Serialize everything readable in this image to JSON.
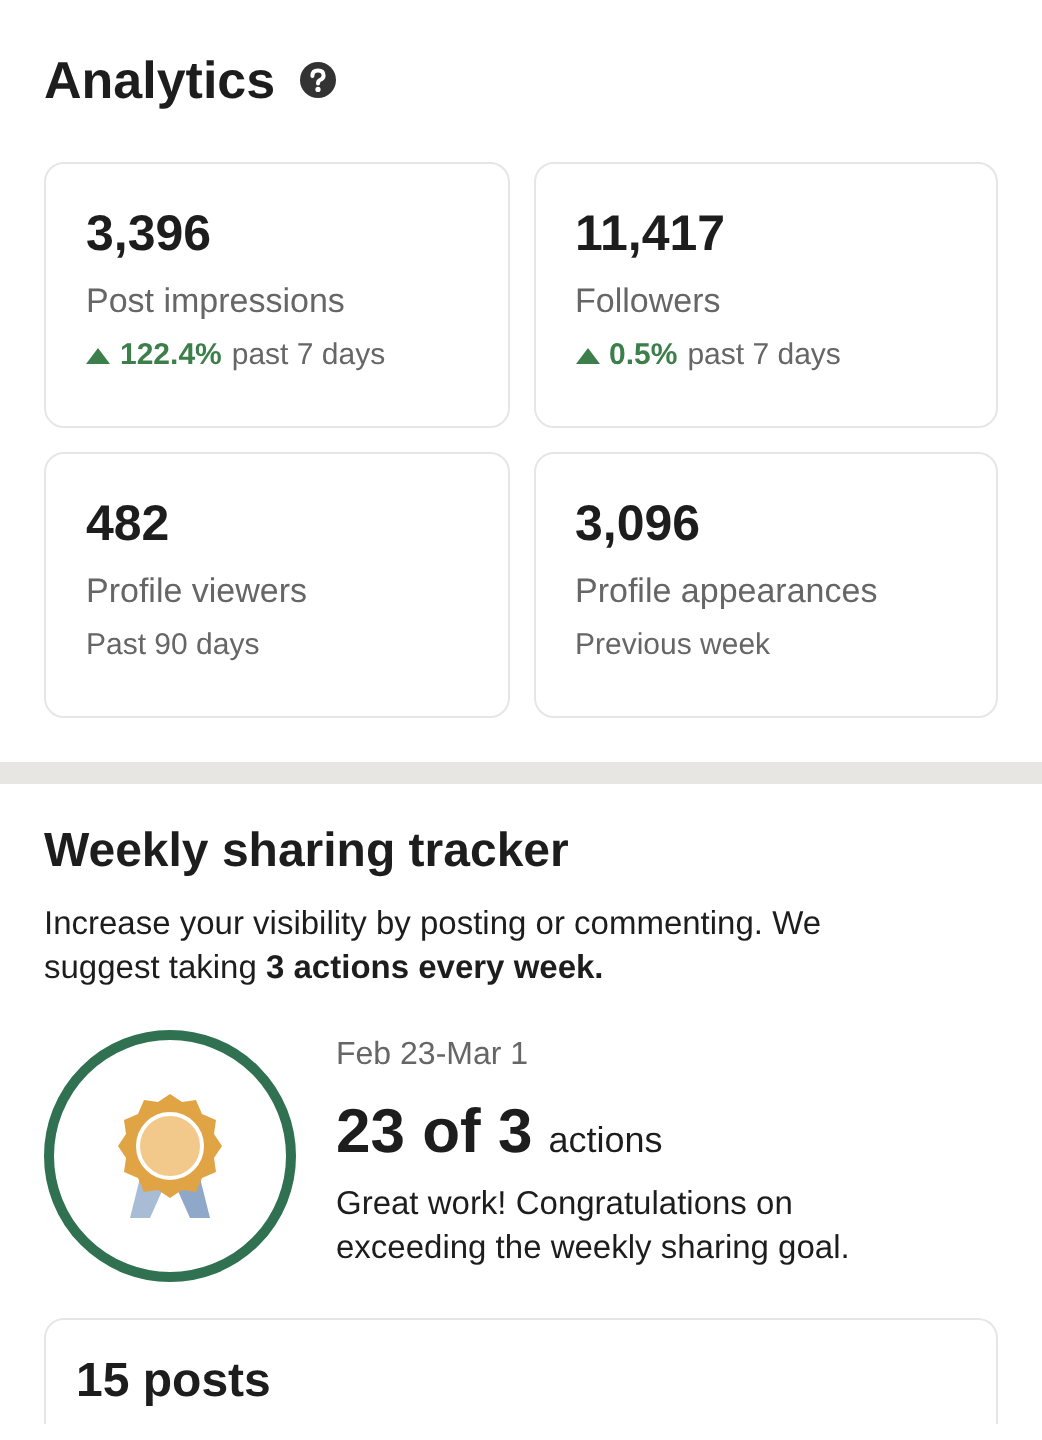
{
  "analytics": {
    "title": "Analytics",
    "stats": [
      {
        "value": "3,396",
        "label": "Post impressions",
        "trend": {
          "kind": "up",
          "change": "122.4%",
          "period": "past 7 days"
        }
      },
      {
        "value": "11,417",
        "label": "Followers",
        "trend": {
          "kind": "up",
          "change": "0.5%",
          "period": "past 7 days"
        }
      },
      {
        "value": "482",
        "label": "Profile viewers",
        "note": "Past 90 days"
      },
      {
        "value": "3,096",
        "label": "Profile appearances",
        "note": "Previous week"
      }
    ]
  },
  "tracker": {
    "title": "Weekly sharing tracker",
    "description": "Increase your visibility by posting or commenting. We suggest taking **3 actions every week.**",
    "goal_met": true,
    "dates": "Feb 23-Mar 1",
    "count": "23 of 3",
    "unit": "actions",
    "message": "Great work! Congratulations on exceeding the weekly sharing goal.",
    "summary": "**15** posts"
  }
}
